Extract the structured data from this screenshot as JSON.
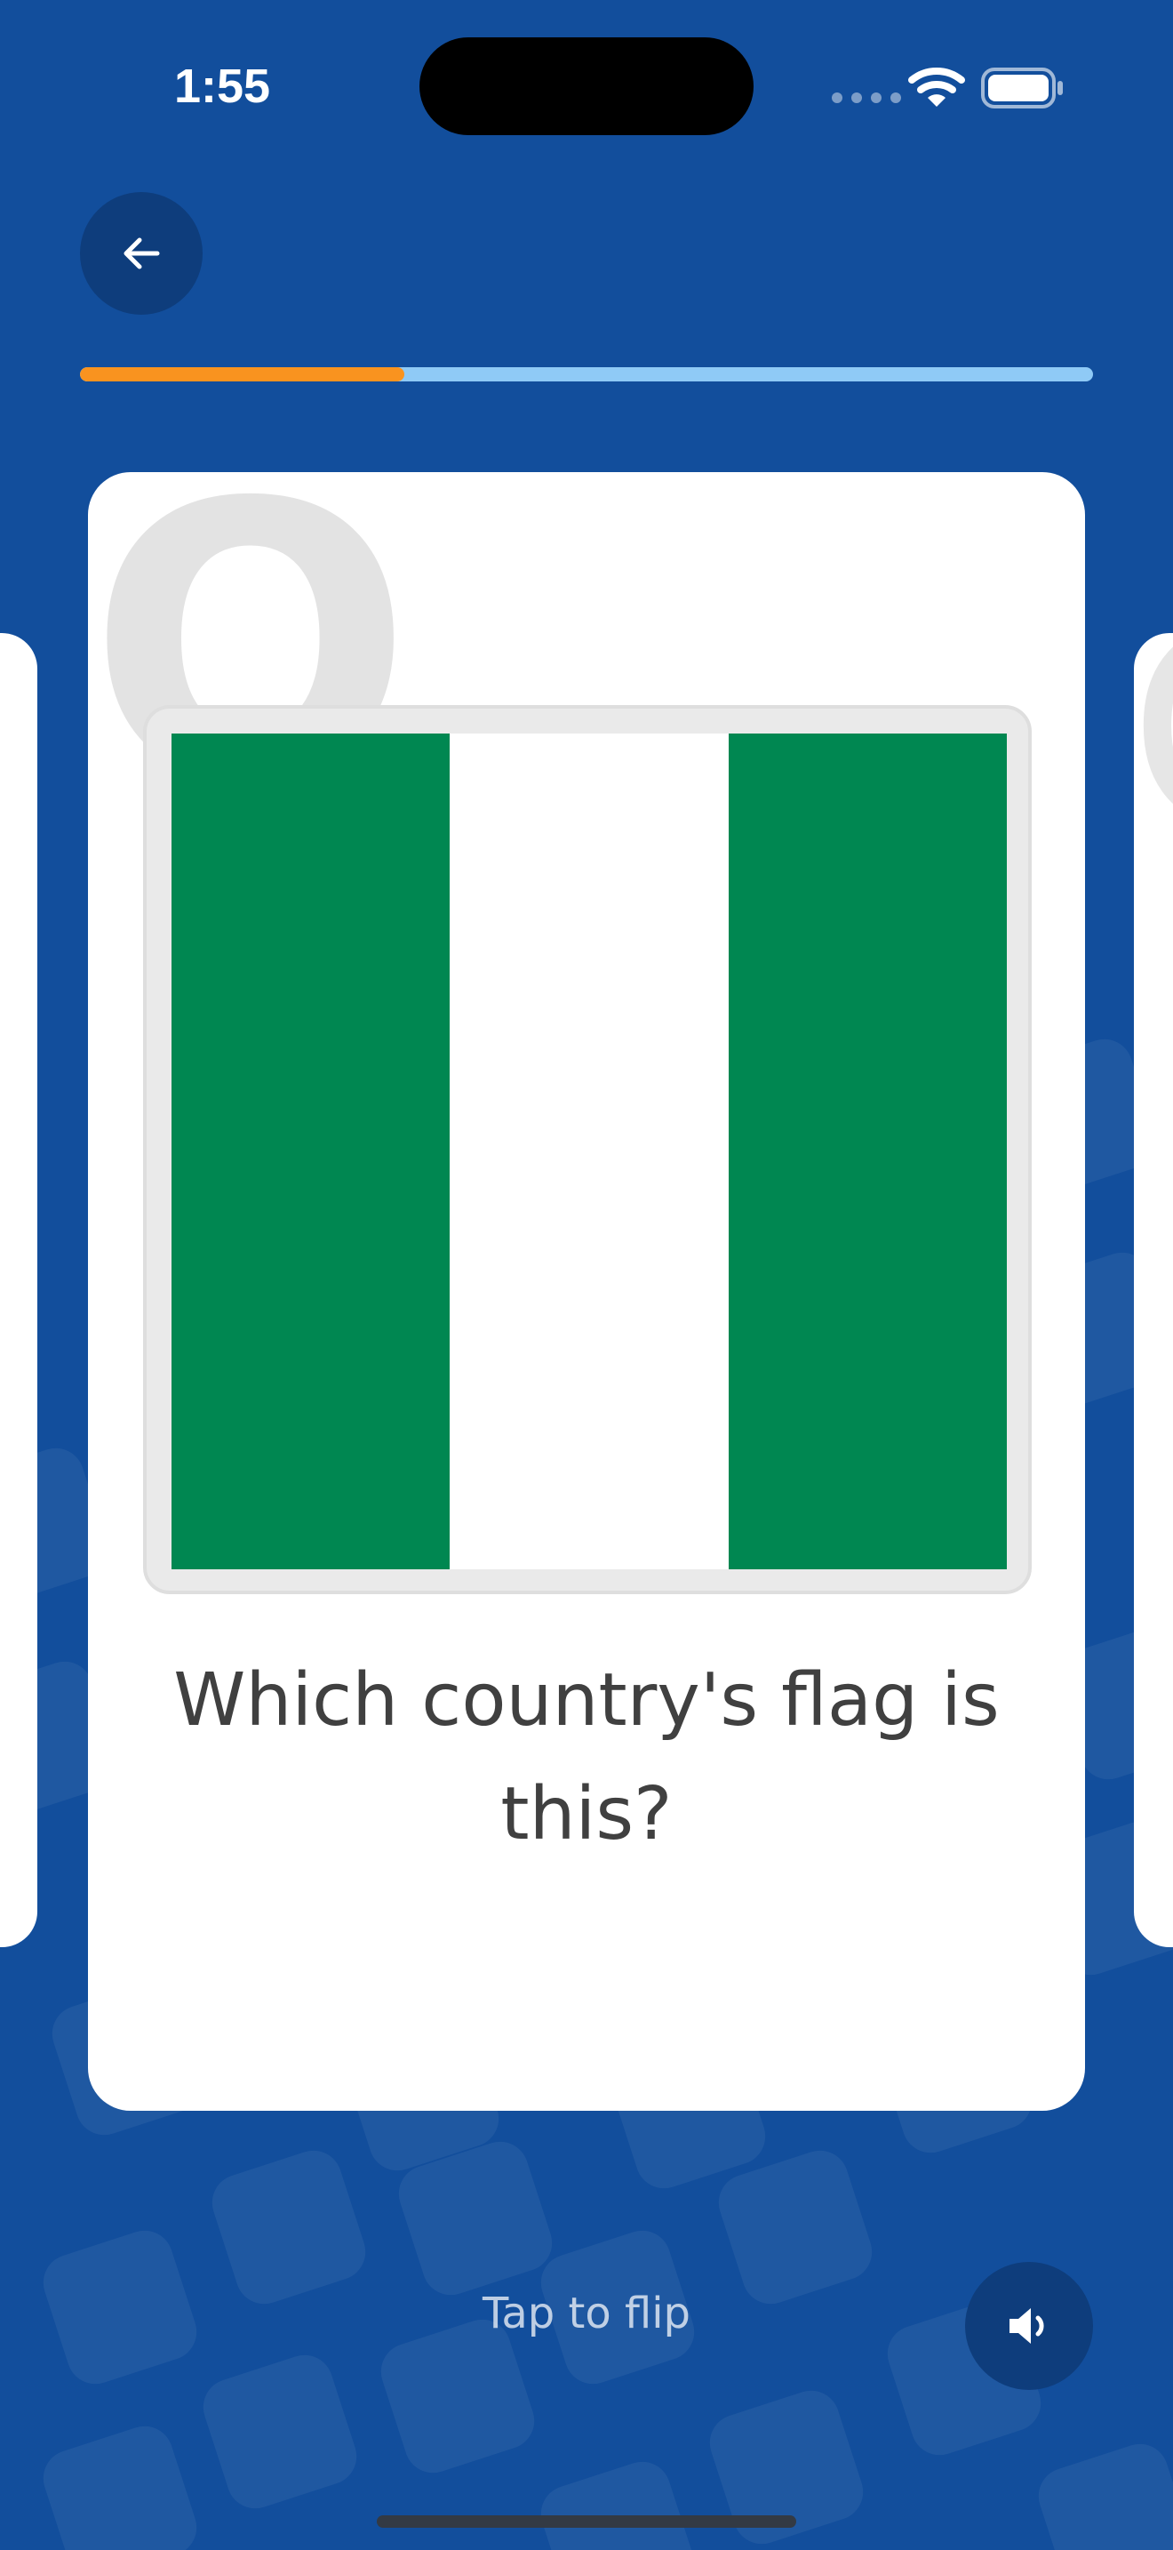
{
  "status_bar": {
    "time": "1:55"
  },
  "progress": {
    "fraction": 0.32,
    "fill_color": "#f9931f",
    "track_color": "#8fcaf6"
  },
  "card": {
    "badge": "Q",
    "flag_colors": [
      "#008751",
      "#ffffff",
      "#008751"
    ],
    "question": "Which country's flag is this?"
  },
  "footer": {
    "hint": "Tap to flip"
  },
  "icons": {
    "back": "back-arrow-icon",
    "sound": "speaker-icon",
    "wifi": "wifi-icon",
    "battery": "battery-icon"
  },
  "colors": {
    "background": "#124e9c",
    "button": "#0e3d7c"
  }
}
